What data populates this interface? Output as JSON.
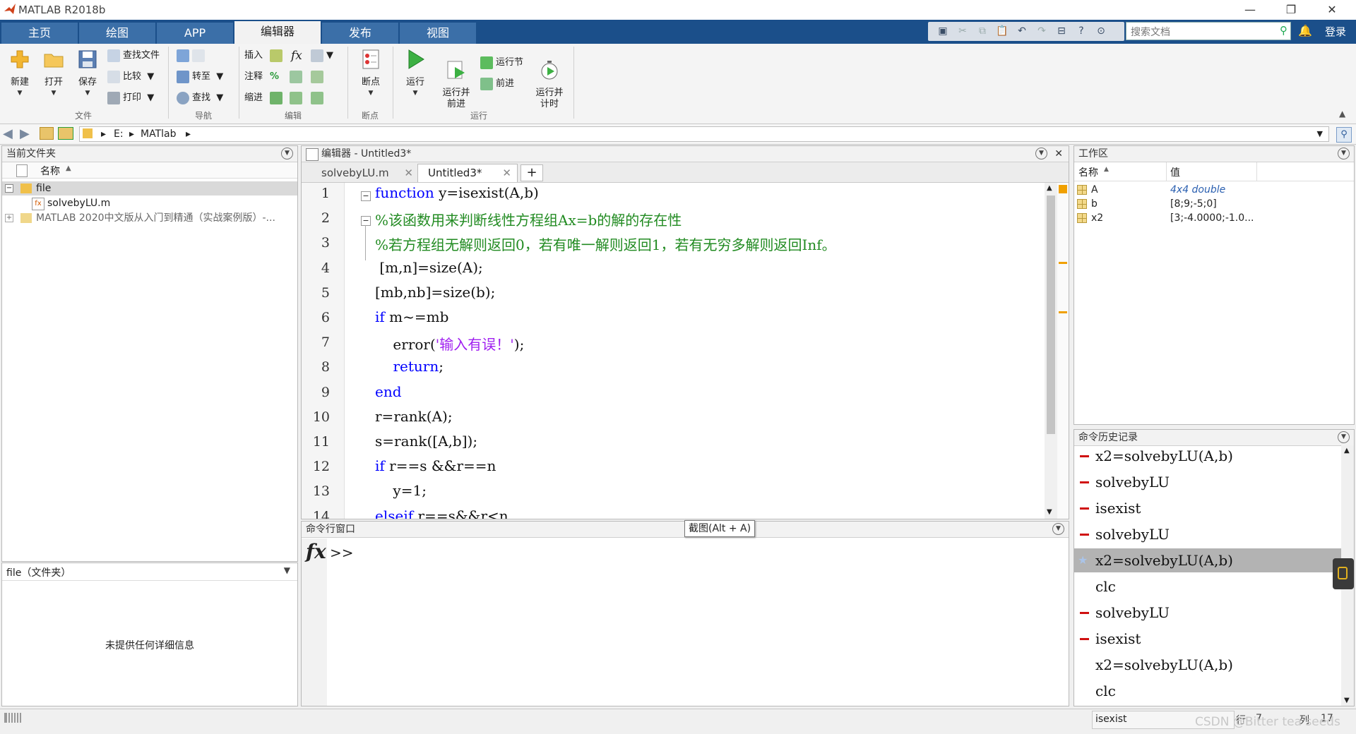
{
  "window": {
    "title": "MATLAB R2018b"
  },
  "tabs": [
    {
      "label": "主页"
    },
    {
      "label": "绘图"
    },
    {
      "label": "APP"
    },
    {
      "label": "编辑器"
    },
    {
      "label": "发布"
    },
    {
      "label": "视图"
    }
  ],
  "header": {
    "search_placeholder": "搜索文档",
    "login": "登录"
  },
  "ribbon": {
    "file": {
      "new": "新建",
      "open": "打开",
      "save": "保存",
      "find_files": "查找文件",
      "compare": "比较",
      "print": "打印",
      "group": "文件"
    },
    "nav": {
      "goto": "转至",
      "find": "查找",
      "group": "导航"
    },
    "edit": {
      "insert": "插入",
      "comment": "注释",
      "indent": "缩进",
      "fx": "fx",
      "group": "编辑"
    },
    "breakpoints": {
      "label": "断点",
      "group": "断点"
    },
    "run": {
      "run": "运行",
      "run_advance": "运行并\n前进",
      "run_section": "运行节",
      "advance": "前进",
      "run_time": "运行并\n计时",
      "group": "运行"
    }
  },
  "address": {
    "segments": [
      "E:",
      "MATlab"
    ]
  },
  "current_folder": {
    "title": "当前文件夹",
    "col_name": "名称",
    "items": [
      {
        "name": "file",
        "level": 0,
        "selected": true
      },
      {
        "name": "solvebyLU.m",
        "level": 1
      },
      {
        "name": "MATLAB 2020中文版从入门到精通（实战案例版）-...",
        "level": 0
      }
    ],
    "details_title": "file（文件夹）",
    "details_empty": "未提供任何详细信息"
  },
  "editor": {
    "title": "编辑器 - Untitled3*",
    "tabs": [
      {
        "label": "solvebyLU.m"
      },
      {
        "label": "Untitled3*"
      }
    ],
    "lines": [
      {
        "n": "1",
        "tokens": [
          {
            "t": "function",
            "c": "kw"
          },
          {
            "t": " y=isexist(A,b)",
            "c": ""
          }
        ]
      },
      {
        "n": "2",
        "tokens": [
          {
            "t": "%该函数用来判断线性方程组Ax=b的解的存在性",
            "c": "cm"
          }
        ]
      },
      {
        "n": "3",
        "tokens": [
          {
            "t": "%若方程组无解则返回0，若有唯一解则返回1，若有无穷多解则返回Inf。",
            "c": "cm"
          }
        ]
      },
      {
        "n": "4",
        "tokens": [
          {
            "t": " [m,n]=size(A);",
            "c": ""
          }
        ]
      },
      {
        "n": "5",
        "tokens": [
          {
            "t": "[mb,nb]=size(b);",
            "c": ""
          }
        ]
      },
      {
        "n": "6",
        "tokens": [
          {
            "t": "if",
            "c": "kw"
          },
          {
            "t": " m~=mb",
            "c": ""
          }
        ]
      },
      {
        "n": "7",
        "tokens": [
          {
            "t": "    error(",
            "c": ""
          },
          {
            "t": "'输入有误！'",
            "c": "st"
          },
          {
            "t": ");",
            "c": ""
          }
        ]
      },
      {
        "n": "8",
        "tokens": [
          {
            "t": "    ",
            "c": ""
          },
          {
            "t": "return",
            "c": "kw"
          },
          {
            "t": ";",
            "c": ""
          }
        ]
      },
      {
        "n": "9",
        "tokens": [
          {
            "t": "end",
            "c": "kw"
          }
        ]
      },
      {
        "n": "10",
        "tokens": [
          {
            "t": "r=rank(A);",
            "c": ""
          }
        ]
      },
      {
        "n": "11",
        "tokens": [
          {
            "t": "s=rank([A,b]);",
            "c": ""
          }
        ]
      },
      {
        "n": "12",
        "tokens": [
          {
            "t": "if",
            "c": "kw"
          },
          {
            "t": " r==s &&r==n",
            "c": ""
          }
        ]
      },
      {
        "n": "13",
        "tokens": [
          {
            "t": "    y=1;",
            "c": ""
          }
        ]
      },
      {
        "n": "14",
        "tokens": [
          {
            "t": "elseif",
            "c": "kw"
          },
          {
            "t": " r==s&&r<n",
            "c": ""
          }
        ]
      }
    ]
  },
  "command_window": {
    "title": "命令行窗口",
    "prompt": ">>",
    "tooltip": "截图(Alt + A)"
  },
  "workspace": {
    "title": "工作区",
    "col_name": "名称",
    "col_value": "值",
    "vars": [
      {
        "name": "A",
        "value": "4x4 double"
      },
      {
        "name": "b",
        "value": "[8;9;-5;0]"
      },
      {
        "name": "x2",
        "value": "[3;-4.0000;-1.0..."
      }
    ]
  },
  "history": {
    "title": "命令历史记录",
    "items": [
      {
        "text": "x2=solvebyLU(A,b)",
        "err": true
      },
      {
        "text": "solvebyLU",
        "err": true
      },
      {
        "text": "isexist",
        "err": true
      },
      {
        "text": "solvebyLU",
        "err": true
      },
      {
        "text": "x2=solvebyLU(A,b)",
        "err": false,
        "selected": true
      },
      {
        "text": "clc",
        "err": false
      },
      {
        "text": "solvebyLU",
        "err": true
      },
      {
        "text": "isexist",
        "err": true
      },
      {
        "text": "x2=solvebyLU(A,b)",
        "err": false
      },
      {
        "text": "clc",
        "err": false
      }
    ]
  },
  "status": {
    "function": "isexist",
    "row_label": "行",
    "row": "7",
    "col_label": "列",
    "col": "17",
    "watermark": "CSDN @Bitter tea seeds"
  }
}
